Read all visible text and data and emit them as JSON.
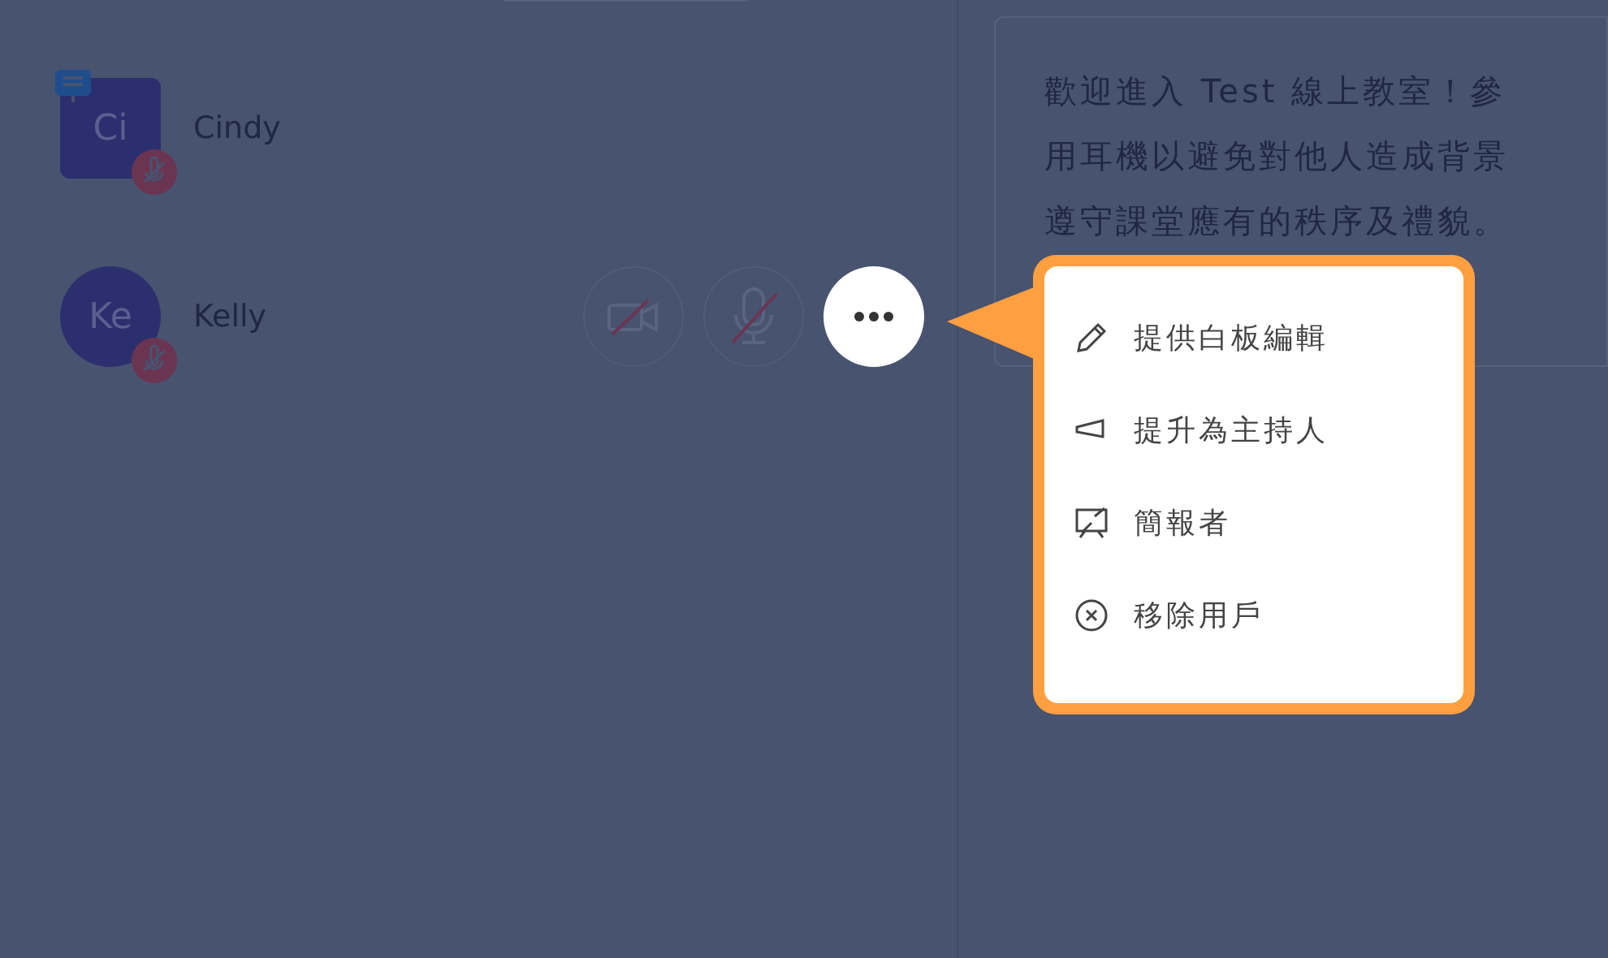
{
  "participants": [
    {
      "initials": "Ci",
      "name": "Cindy",
      "kind": "square",
      "presenter": true,
      "controls": false
    },
    {
      "initials": "Ke",
      "name": "Kelly",
      "kind": "circle",
      "presenter": false,
      "controls": true
    }
  ],
  "welcome": {
    "lines": [
      "歡迎進入 Test 線上教室！參",
      "用耳機以避免對他人造成背景",
      "遵守課堂應有的秩序及禮貌。"
    ]
  },
  "menu": {
    "items": [
      {
        "kind": "pencil",
        "label": "提供白板編輯"
      },
      {
        "kind": "megaphone",
        "label": "提升為主持人"
      },
      {
        "kind": "presenter",
        "label": "簡報者"
      },
      {
        "kind": "remove",
        "label": "移除用戶"
      }
    ]
  }
}
